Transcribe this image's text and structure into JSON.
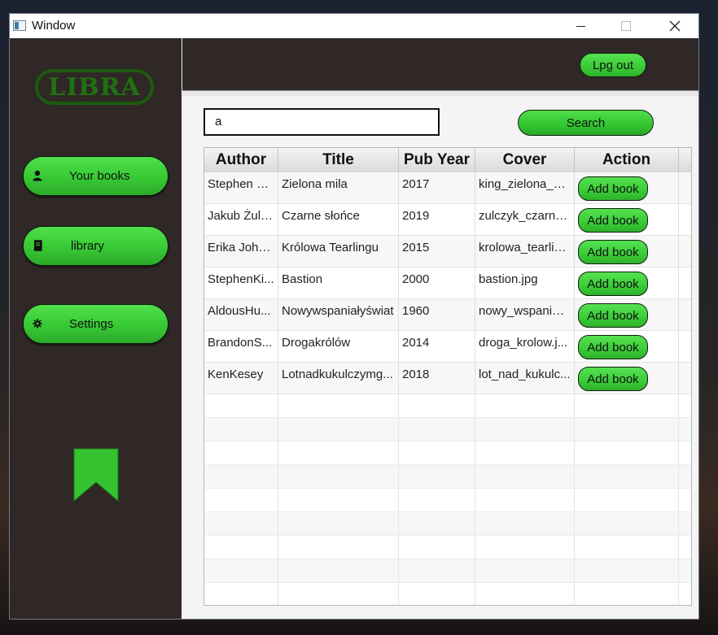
{
  "window": {
    "title": "Window"
  },
  "sidebar": {
    "logo_text": "LIBRA",
    "items": [
      {
        "label": "Your books",
        "icon": "user-icon"
      },
      {
        "label": "library",
        "icon": "book-icon"
      },
      {
        "label": "Settings",
        "icon": "gear-icon"
      }
    ],
    "bookmark_icon": "bookmark-icon"
  },
  "header": {
    "logout_label": "Lpg out"
  },
  "search": {
    "value": "a",
    "button_label": "Search"
  },
  "table": {
    "columns": [
      "Author",
      "Title",
      "Pub Year",
      "Cover",
      "Action"
    ],
    "rows": [
      {
        "author": "Stephen Ki...",
        "title": "Zielona mila",
        "year": "2017",
        "cover": "king_zielona_m...",
        "action": "Add book"
      },
      {
        "author": "Jakub Żulk...",
        "title": "Czarne słońce",
        "year": "2019",
        "cover": "zulczyk_czarne...",
        "action": "Add book"
      },
      {
        "author": "Erika Joha...",
        "title": "Królowa Tearlingu",
        "year": "2015",
        "cover": "krolowa_tearlin...",
        "action": "Add book"
      },
      {
        "author": "StephenKi...",
        "title": "Bastion",
        "year": "2000",
        "cover": "bastion.jpg",
        "action": "Add book"
      },
      {
        "author": "AldousHu...",
        "title": "Nowywspaniałyświat",
        "year": "1960",
        "cover": "nowy_wspanial...",
        "action": "Add book"
      },
      {
        "author": "BrandonS...",
        "title": "Drogakrólów",
        "year": "2014",
        "cover": "droga_krolow.j...",
        "action": "Add book"
      },
      {
        "author": "KenKesey",
        "title": "Lotnadkukulczymg...",
        "year": "2018",
        "cover": "lot_nad_kukulc...",
        "action": "Add book"
      }
    ]
  },
  "colors": {
    "accent_green": "#3acb37",
    "logo_green": "#217111",
    "sidebar_bg": "#2f2827"
  }
}
